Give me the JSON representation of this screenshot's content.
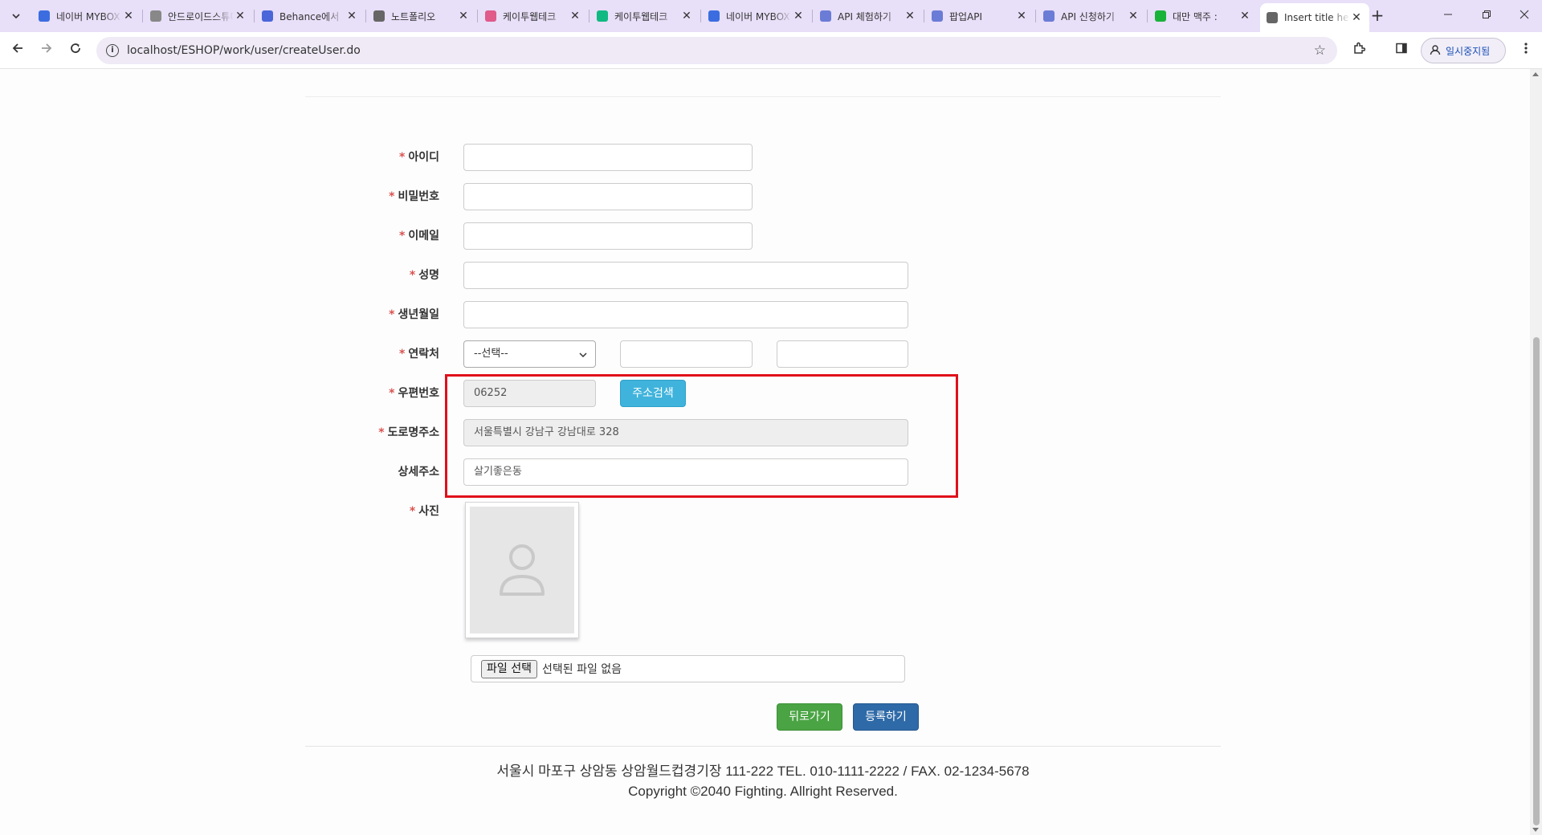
{
  "tabs": [
    {
      "title": "네이버 MYBOX",
      "color": "#3b6de0"
    },
    {
      "title": "안드로이드스튜디오",
      "color": "#888888"
    },
    {
      "title": "Behance에서",
      "color": "#4a66d8"
    },
    {
      "title": "노트폴리오",
      "color": "#666666"
    },
    {
      "title": "케이투웹테크",
      "color": "#e05a8a"
    },
    {
      "title": "케이투웹테크",
      "color": "#10b981"
    },
    {
      "title": "네이버 MYBOX",
      "color": "#3b6de0"
    },
    {
      "title": "API 체험하기",
      "color": "#6b7cd6"
    },
    {
      "title": "팝업API",
      "color": "#6b7cd6"
    },
    {
      "title": "API 신청하기",
      "color": "#6b7cd6"
    },
    {
      "title": "대만 맥주 :",
      "color": "#19b33a"
    },
    {
      "title": "Insert title here",
      "color": "#666666"
    }
  ],
  "tab_close_glyph": "✕",
  "new_tab_glyph": "+",
  "address": {
    "url": "localhost/ESHOP/work/user/createUser.do"
  },
  "pause_label": "일시중지됨",
  "form": {
    "required_mark": "*",
    "id_label": "아이디",
    "password_label": "비밀번호",
    "email_label": "이메일",
    "name_label": "성명",
    "birth_label": "생년월일",
    "phone_label": "연락처",
    "phone_select_value": "--선택--",
    "zip_label": "우편번호",
    "zip_value": "06252",
    "address_search_button": "주소검색",
    "road_address_label": "도로명주소",
    "road_address_value": "서울특별시 강남구 강남대로 328",
    "detail_address_label": "상세주소",
    "detail_address_value": "살기좋은동",
    "photo_label": "사진",
    "file_button": "파일 선택",
    "file_status": "선택된 파일 없음",
    "back_button": "뒤로가기",
    "submit_button": "등록하기"
  },
  "footer": {
    "address_line": "서울시 마포구 상암동 상암월드컵경기장 111-222 TEL. 010-1111-2222 / FAX. 02-1234-5678",
    "copyright": "Copyright ©2040 Fighting. Allright Reserved."
  },
  "colors": {
    "accent_info": "#3fb3dc",
    "success": "#4aa443",
    "primary": "#2f6aa8",
    "required": "#d9534f",
    "highlight": "#e0101a"
  }
}
